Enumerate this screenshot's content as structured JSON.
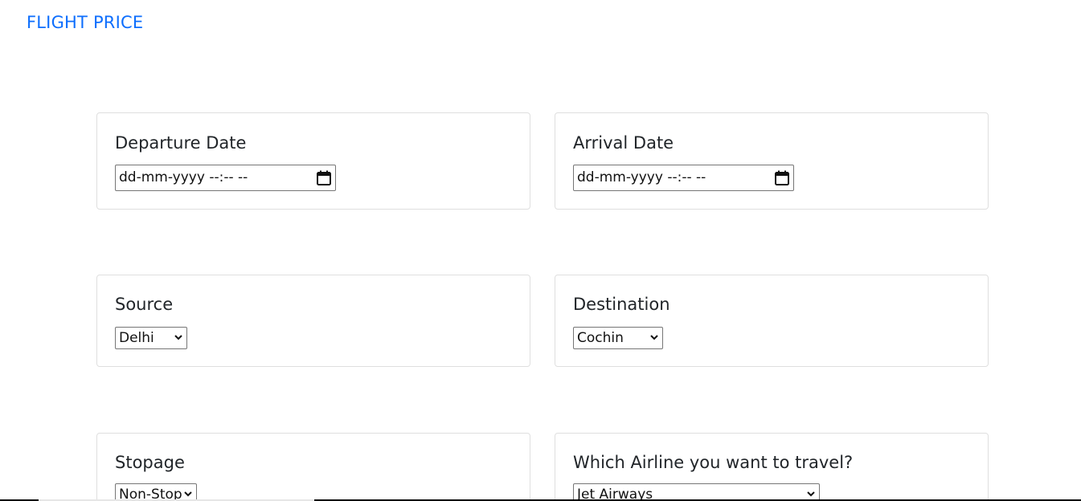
{
  "nav": {
    "brand": "FLIGHT PRICE"
  },
  "departure": {
    "label": "Departure Date",
    "placeholder": "dd-mm-yyyy --:-- --"
  },
  "arrival": {
    "label": "Arrival Date",
    "placeholder": "dd-mm-yyyy --:-- --"
  },
  "source": {
    "label": "Source",
    "selected": "Delhi"
  },
  "destination": {
    "label": "Destination",
    "selected": "Cochin"
  },
  "stopage": {
    "label": "Stopage",
    "selected": "Non-Stop"
  },
  "airline": {
    "label": "Which Airline you want to travel?",
    "selected": "Jet Airways"
  },
  "colors": {
    "brand": "#0d6efd",
    "card_border": "#dfdfdf",
    "text": "#212529"
  }
}
